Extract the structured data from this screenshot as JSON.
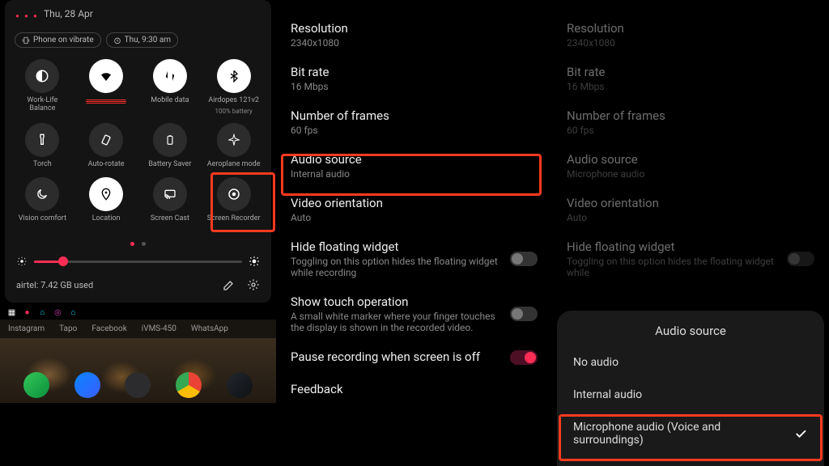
{
  "panel1": {
    "time_fragment": "· · ·",
    "date": "Thu, 28 Apr",
    "pills": [
      {
        "icon": "vibrate-icon",
        "label": "Phone on vibrate"
      },
      {
        "icon": "alarm-icon",
        "label": "Thu, 9:30 am"
      }
    ],
    "tiles": [
      {
        "icon": "balance-icon",
        "label": "Work-Life Balance",
        "on": false
      },
      {
        "icon": "wifi-icon",
        "label": "",
        "on": true,
        "strike": true
      },
      {
        "icon": "swap-icon",
        "label": "Mobile data",
        "on": true
      },
      {
        "icon": "bluetooth-icon",
        "label": "Airdopes 121v2",
        "sub": "100% battery",
        "on": true
      },
      {
        "icon": "torch-icon",
        "label": "Torch",
        "on": false
      },
      {
        "icon": "rotate-icon",
        "label": "Auto-rotate",
        "on": false
      },
      {
        "icon": "battery-icon",
        "label": "Battery Saver",
        "on": false
      },
      {
        "icon": "airplane-icon",
        "label": "Aeroplane mode",
        "on": false
      },
      {
        "icon": "moon-icon",
        "label": "Vision comfort",
        "on": false
      },
      {
        "icon": "location-icon",
        "label": "Location",
        "on": true
      },
      {
        "icon": "cast-icon",
        "label": "Screen Cast",
        "on": false
      },
      {
        "icon": "record-icon",
        "label": "Screen Recorder",
        "on": false
      }
    ],
    "data_usage": "airtel: 7.42 GB used",
    "home_apps": [
      "Instagram",
      "Tapo",
      "Facebook",
      "iVMS-450",
      "WhatsApp"
    ]
  },
  "panel2": {
    "items": [
      {
        "title": "Resolution",
        "sub": "2340x1080"
      },
      {
        "title": "Bit rate",
        "sub": "16 Mbps"
      },
      {
        "title": "Number of frames",
        "sub": "60 fps"
      },
      {
        "title": "Audio source",
        "sub": "Internal audio",
        "highlight": true
      },
      {
        "title": "Video orientation",
        "sub": "Auto"
      },
      {
        "title": "Hide floating widget",
        "sub": "Toggling on this option hides the floating widget while recording",
        "toggle": "off"
      },
      {
        "title": "Show touch operation",
        "sub": "A small white marker where your finger touches the display is shown in the recorded video.",
        "toggle": "off"
      },
      {
        "title": "Pause recording when screen is off",
        "toggle": "on"
      },
      {
        "title": "Feedback"
      }
    ]
  },
  "panel3": {
    "items": [
      {
        "title": "Resolution",
        "sub": "2340x1080"
      },
      {
        "title": "Bit rate",
        "sub": "16 Mbps"
      },
      {
        "title": "Number of frames",
        "sub": "60 fps"
      },
      {
        "title": "Audio source",
        "sub": "Microphone audio"
      },
      {
        "title": "Video orientation",
        "sub": "Auto"
      },
      {
        "title": "Hide floating widget",
        "sub": "Toggling on this option hides the floating widget while",
        "toggle": "off"
      }
    ],
    "dialog": {
      "title": "Audio source",
      "options": [
        {
          "label": "No audio",
          "selected": false
        },
        {
          "label": "Internal audio",
          "selected": false
        },
        {
          "label": "Microphone audio (Voice and surroundings)",
          "selected": true,
          "highlight": true
        }
      ]
    }
  }
}
